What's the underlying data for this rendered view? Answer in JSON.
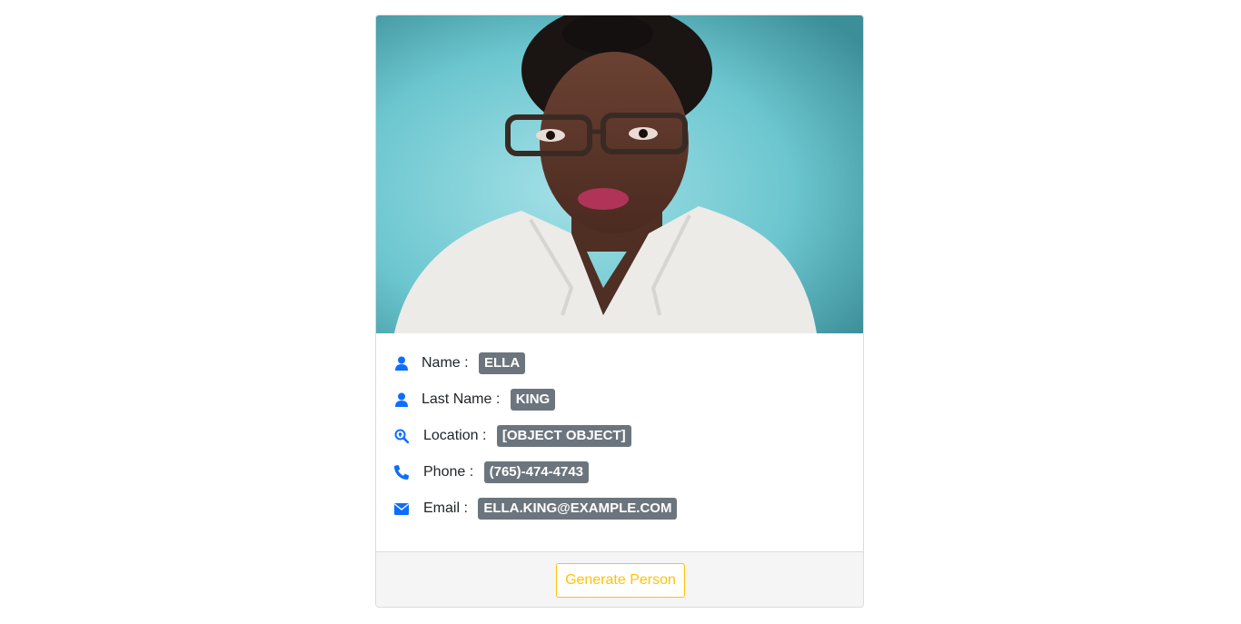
{
  "profile": {
    "photo_alt": "Portrait photo",
    "fields": [
      {
        "icon": "user-icon",
        "label": "Name : ",
        "value": "Ella"
      },
      {
        "icon": "user-icon",
        "label": "Last Name : ",
        "value": "King"
      },
      {
        "icon": "search-location-icon",
        "label": "Location : ",
        "value": "[object Object]"
      },
      {
        "icon": "phone-icon",
        "label": "Phone : ",
        "value": "(765)-474-4743"
      },
      {
        "icon": "envelope-icon",
        "label": "Email : ",
        "value": "ella.king@example.com"
      }
    ]
  },
  "footer": {
    "generate_label": "Generate Person"
  },
  "colors": {
    "icon": "#0d6efd",
    "badge": "#6c757d",
    "button": "#ffc107",
    "photo_background": "#5fbfc9"
  }
}
